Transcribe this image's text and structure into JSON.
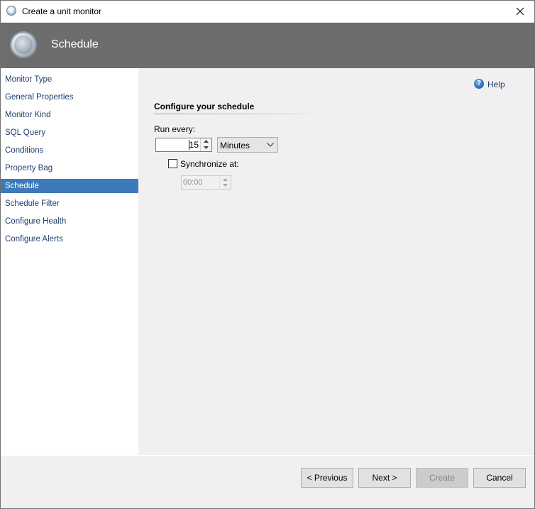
{
  "window": {
    "title": "Create a unit monitor"
  },
  "banner": {
    "title": "Schedule"
  },
  "nav": {
    "items": [
      {
        "label": "Monitor Type"
      },
      {
        "label": "General Properties"
      },
      {
        "label": "Monitor Kind"
      },
      {
        "label": "SQL Query"
      },
      {
        "label": "Conditions"
      },
      {
        "label": "Property Bag"
      },
      {
        "label": "Schedule",
        "selected": true
      },
      {
        "label": "Schedule Filter"
      },
      {
        "label": "Configure Health"
      },
      {
        "label": "Configure Alerts"
      }
    ]
  },
  "help": {
    "label": "Help",
    "icon": "help-icon",
    "glyph": "?"
  },
  "schedule": {
    "section_title": "Configure your schedule",
    "run_every_label": "Run every:",
    "run_every_value": "15",
    "unit_selected": "Minutes",
    "synchronize_label": "Synchronize at:",
    "synchronize_checked": false,
    "synchronize_time": "00:00"
  },
  "footer": {
    "previous_label": "< Previous",
    "next_label": "Next >",
    "create_label": "Create",
    "create_enabled": false,
    "cancel_label": "Cancel"
  },
  "colors": {
    "banner_bg": "#6d6d6d",
    "nav_selected_bg": "#3d7ab9",
    "nav_text": "#1f3f6e",
    "window_bg": "#f0f0f0"
  }
}
